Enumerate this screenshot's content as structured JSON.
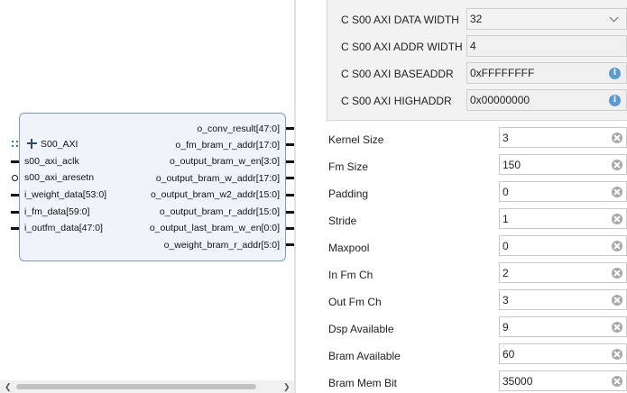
{
  "ip_block": {
    "bus_interface": "S00_AXI",
    "left_ports": [
      "s00_axi_aclk",
      "s00_axi_aresetn",
      "i_weight_data[53:0]",
      "i_fm_data[59:0]",
      "i_outfm_data[47:0]"
    ],
    "right_ports": [
      "o_conv_result[47:0]",
      "o_fm_bram_r_addr[17:0]",
      "o_output_bram_w_en[3:0]",
      "o_output_bram_w_addr[17:0]",
      "o_output_bram_w2_addr[15:0]",
      "o_output_bram_r_addr[15:0]",
      "o_output_last_bram_w_en[0:0]",
      "o_weight_bram_r_addr[5:0]"
    ]
  },
  "axi_params": [
    {
      "label": "C S00 AXI DATA WIDTH",
      "value": "32",
      "control": "dropdown"
    },
    {
      "label": "C S00 AXI ADDR WIDTH",
      "value": "4",
      "control": "readonly"
    },
    {
      "label": "C S00 AXI BASEADDR",
      "value": "0xFFFFFFFF",
      "control": "info"
    },
    {
      "label": "C S00 AXI HIGHADDR",
      "value": "0x00000000",
      "control": "info"
    }
  ],
  "params": [
    {
      "label": "Kernel Size",
      "value": "3"
    },
    {
      "label": "Fm Size",
      "value": "150"
    },
    {
      "label": "Padding",
      "value": "0"
    },
    {
      "label": "Stride",
      "value": "1"
    },
    {
      "label": "Maxpool",
      "value": "0"
    },
    {
      "label": "In Fm Ch",
      "value": "2"
    },
    {
      "label": "Out Fm Ch",
      "value": "3"
    },
    {
      "label": "Dsp Available",
      "value": "9"
    },
    {
      "label": "Bram Available",
      "value": "60"
    },
    {
      "label": "Bram Mem Bit",
      "value": "35000"
    }
  ],
  "colors": {
    "accent_info": "#5b9bd5",
    "block_fill": "#eef4fa",
    "block_border": "#7d9ab5"
  }
}
